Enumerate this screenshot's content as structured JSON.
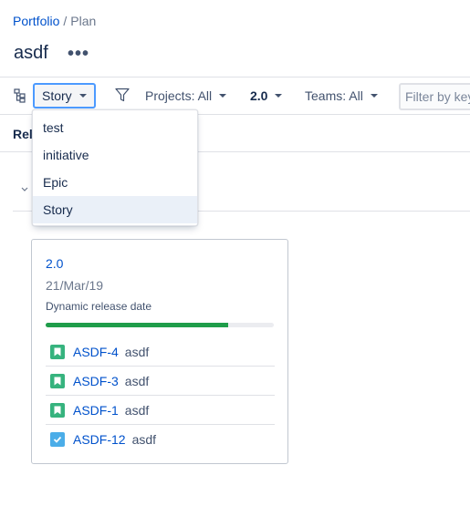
{
  "breadcrumb": {
    "root": "Portfolio",
    "separator": "/",
    "current": "Plan"
  },
  "page": {
    "title": "asdf",
    "more_label": "•••"
  },
  "toolbar": {
    "hierarchy_select": "Story",
    "projects_filter": "Projects: All",
    "release_filter": "2.0",
    "teams_filter": "Teams: All",
    "search_placeholder": "Filter by keyword"
  },
  "tab_label": "Rel",
  "dropdown": {
    "options": [
      {
        "label": "test"
      },
      {
        "label": "initiative"
      },
      {
        "label": "Epic"
      },
      {
        "label": "Story"
      }
    ],
    "selected": "Story"
  },
  "release_card": {
    "version": "2.0",
    "date": "21/Mar/19",
    "subtitle": "Dynamic release date",
    "progress_percent": 80,
    "issues": [
      {
        "key": "ASDF-4",
        "summary": "asdf",
        "type": "story-icon"
      },
      {
        "key": "ASDF-3",
        "summary": "asdf",
        "type": "story-icon"
      },
      {
        "key": "ASDF-1",
        "summary": "asdf",
        "type": "story-icon"
      },
      {
        "key": "ASDF-12",
        "summary": "asdf",
        "type": "task-icon"
      }
    ]
  },
  "colors": {
    "link": "#0052CC",
    "story": "#36B37E",
    "task": "#4BADE8",
    "progress": "#1F9D4A",
    "focus": "#4C9AFF"
  }
}
